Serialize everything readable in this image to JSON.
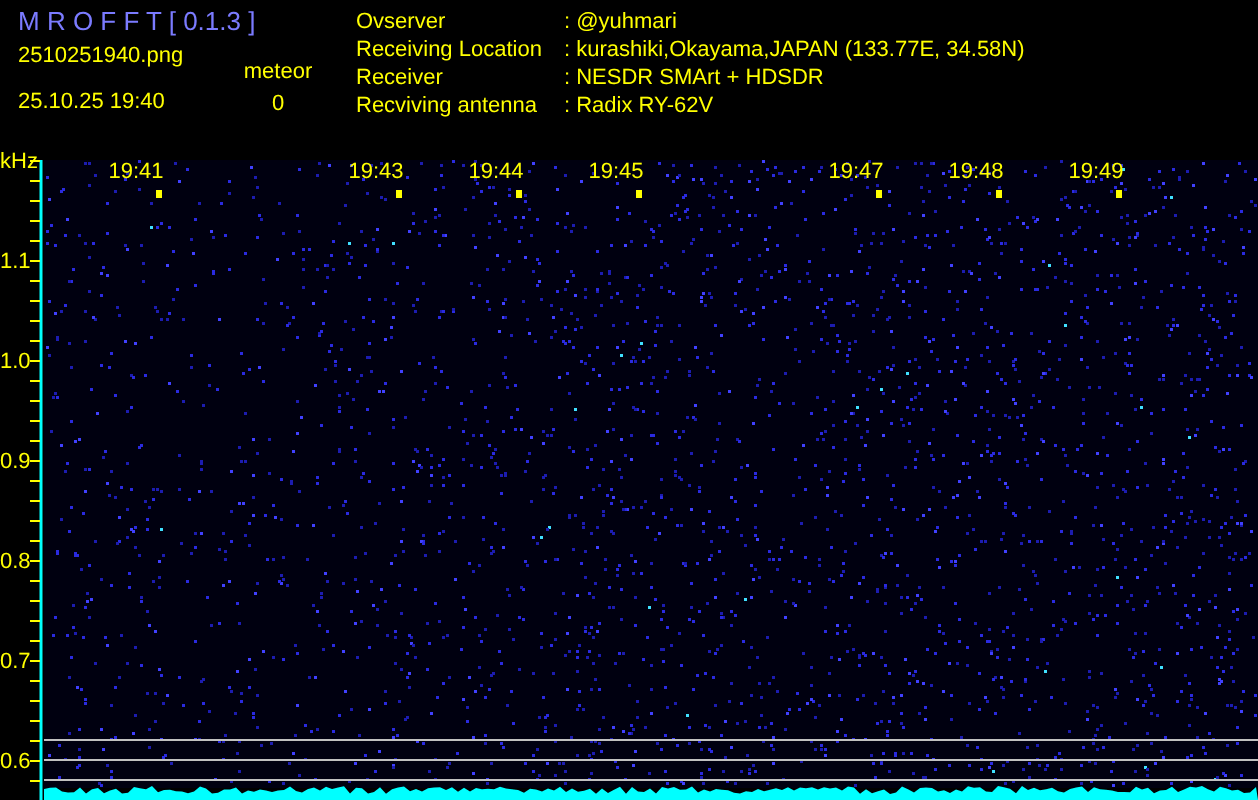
{
  "app_title": "M R O F F T [ 0.1.3 ]",
  "file_name": "2510251940.png",
  "timestamp": "25.10.25 19:40",
  "meteor": {
    "label": "meteor",
    "count": "0"
  },
  "station": [
    {
      "label": "Ovserver",
      "value": ": @yuhmari"
    },
    {
      "label": "Receiving Location",
      "value": ": kurashiki,Okayama,JAPAN (133.77E, 34.58N)"
    },
    {
      "label": "Receiver",
      "value": ": NESDR SMArt + HDSDR"
    },
    {
      "label": "Recviving antenna",
      "value": ": Radix RY-62V"
    }
  ],
  "y_unit": "kHz",
  "y_ticks": [
    "1.1",
    "1.0",
    "0.9",
    "0.8",
    "0.7",
    "0.6"
  ],
  "time_labels": [
    "19:41",
    "19:43",
    "19:44",
    "19:45",
    "19:47",
    "19:48",
    "19:49"
  ]
}
